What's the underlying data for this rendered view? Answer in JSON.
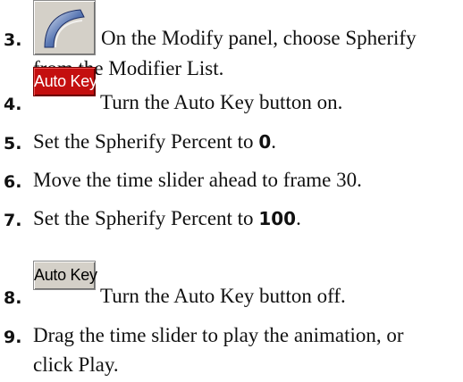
{
  "steps": [
    {
      "number": "3.",
      "lines": [
        "On the Modify panel, choose Spherify",
        "from the Modifier List."
      ],
      "icon": "modify-panel-icon"
    },
    {
      "number": "4.",
      "button_label": "Auto Key",
      "button_color": "#c40f0f",
      "text": "Turn the Auto Key button on."
    },
    {
      "number": "5.",
      "text_before": "Set the Spherify Percent to ",
      "value": "0",
      "text_after": "."
    },
    {
      "number": "6.",
      "text": "Move the time slider ahead to frame 30."
    },
    {
      "number": "7.",
      "text_before": "Set the Spherify Percent to ",
      "value": "100",
      "text_after": "."
    },
    {
      "number": "8.",
      "button_label": "Auto Key",
      "button_color": "#d4d0c8",
      "text": "Turn the Auto Key button off."
    },
    {
      "number": "9.",
      "lines": [
        "Drag the time slider to play the animation, or",
        "click Play."
      ]
    }
  ]
}
